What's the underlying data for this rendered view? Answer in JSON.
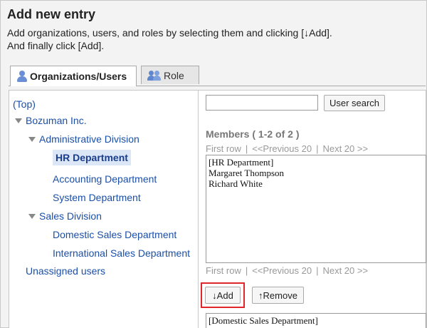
{
  "dialog": {
    "title": "Add new entry",
    "instructions": [
      "Add organizations, users, and roles by selecting them and clicking [↓Add].",
      "And finally click [Add]."
    ]
  },
  "tabs": [
    {
      "label": "Organizations/Users",
      "icon": "person-icon",
      "active": true
    },
    {
      "label": "Role",
      "icon": "role-icon",
      "active": false
    }
  ],
  "tree": {
    "top": "(Top)",
    "company": "Bozuman Inc.",
    "admin_division": "Administrative Division",
    "hr": "HR Department",
    "accounting": "Accounting Department",
    "system": "System Department",
    "sales_division": "Sales Division",
    "domestic_sales": "Domestic Sales Department",
    "international_sales": "International Sales Department",
    "unassigned": "Unassigned users"
  },
  "search": {
    "value": "",
    "button_label": "User search"
  },
  "members": {
    "heading": "Members ( 1-2 of 2 )",
    "pager": {
      "first": "First row",
      "sep": "|",
      "prev": "<<Previous 20",
      "next": "Next 20 >>"
    },
    "items": [
      "[HR Department]",
      "Margaret Thompson",
      "Richard White"
    ]
  },
  "actions": {
    "add_label": "↓Add",
    "remove_label": "↑Remove"
  },
  "selected": {
    "items": [
      "[Domestic Sales Department]"
    ]
  },
  "colors": {
    "link": "#1a4fa8",
    "selected_bg": "#dbe6f7",
    "highlight": "#e0262b"
  }
}
